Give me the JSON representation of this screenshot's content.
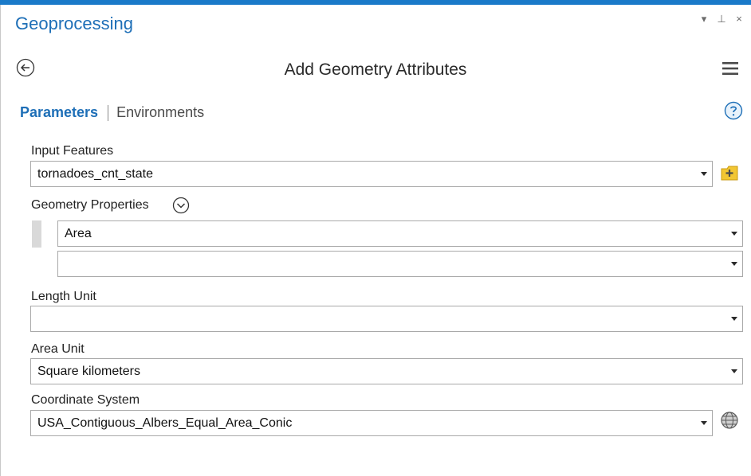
{
  "pane": {
    "title": "Geoprocessing",
    "controls": [
      "▾",
      "⊥",
      "×"
    ]
  },
  "tool": {
    "title": "Add Geometry Attributes"
  },
  "tabs": {
    "parameters": "Parameters",
    "environments": "Environments"
  },
  "params": {
    "input_features": {
      "label": "Input Features",
      "value": "tornadoes_cnt_state"
    },
    "geometry_properties": {
      "label": "Geometry Properties",
      "values": [
        "Area",
        ""
      ]
    },
    "length_unit": {
      "label": "Length Unit",
      "value": ""
    },
    "area_unit": {
      "label": "Area Unit",
      "value": "Square kilometers"
    },
    "coordinate_system": {
      "label": "Coordinate System",
      "value": "USA_Contiguous_Albers_Equal_Area_Conic"
    }
  },
  "colors": {
    "accent": "#1a7ac9",
    "title_blue": "#1e6fb7",
    "folder_yellow": "#f2c633"
  },
  "icons": [
    "back-arrow-icon",
    "hamburger-menu-icon",
    "help-icon",
    "chevron-down-circle-icon",
    "add-folder-icon",
    "globe-icon",
    "dropdown-arrow-icon"
  ]
}
